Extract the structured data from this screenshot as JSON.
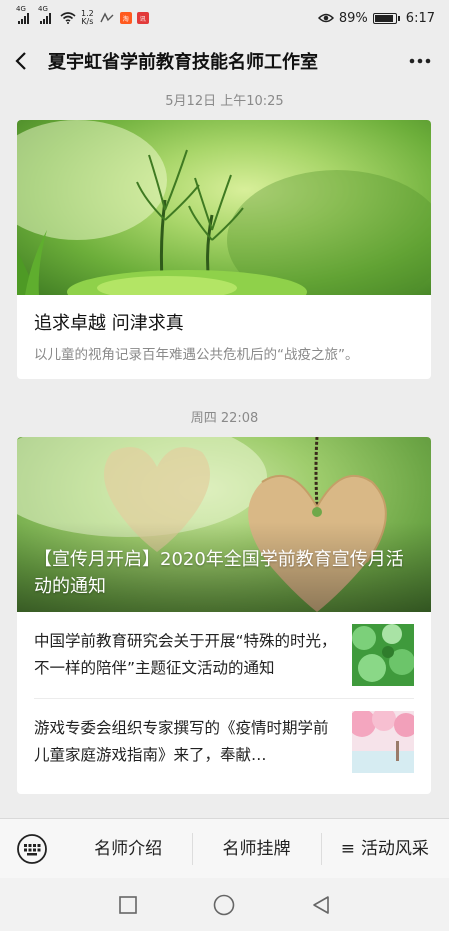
{
  "status_bar": {
    "signal1": "4G",
    "signal2": "4G",
    "speed_value": "1.2",
    "speed_unit": "K/s",
    "battery": "89%",
    "time": "6:17",
    "eye_icon": "eye-icon"
  },
  "nav": {
    "title": "夏宇虹省学前教育技能名师工作室",
    "back_icon": "back-arrow-icon",
    "more_icon": "more-dots-icon"
  },
  "feed": [
    {
      "time": "5月12日 上午10:25",
      "title": "追求卓越 问津求真",
      "summary": "以儿童的视角记录百年难遇公共危机后的“战疫之旅”。"
    },
    {
      "time": "周四 22:08",
      "headline": "【宣传月开启】2020年全国学前教育宣传月活动的通知",
      "items": [
        {
          "text": "中国学前教育研究会关于开展“特殊的时光，不一样的陪伴”主题征文活动的通知"
        },
        {
          "text": "游戏专委会组织专家撰写的《疫情时期学前儿童家庭游戏指南》来了，奉献…"
        }
      ]
    }
  ],
  "menu": {
    "keyboard_icon": "keyboard-icon",
    "items": [
      "名师介绍",
      "名师挂牌",
      "活动风采"
    ],
    "third_prefix": "≡"
  },
  "system_nav": [
    "square-icon",
    "circle-icon",
    "triangle-back-icon"
  ]
}
